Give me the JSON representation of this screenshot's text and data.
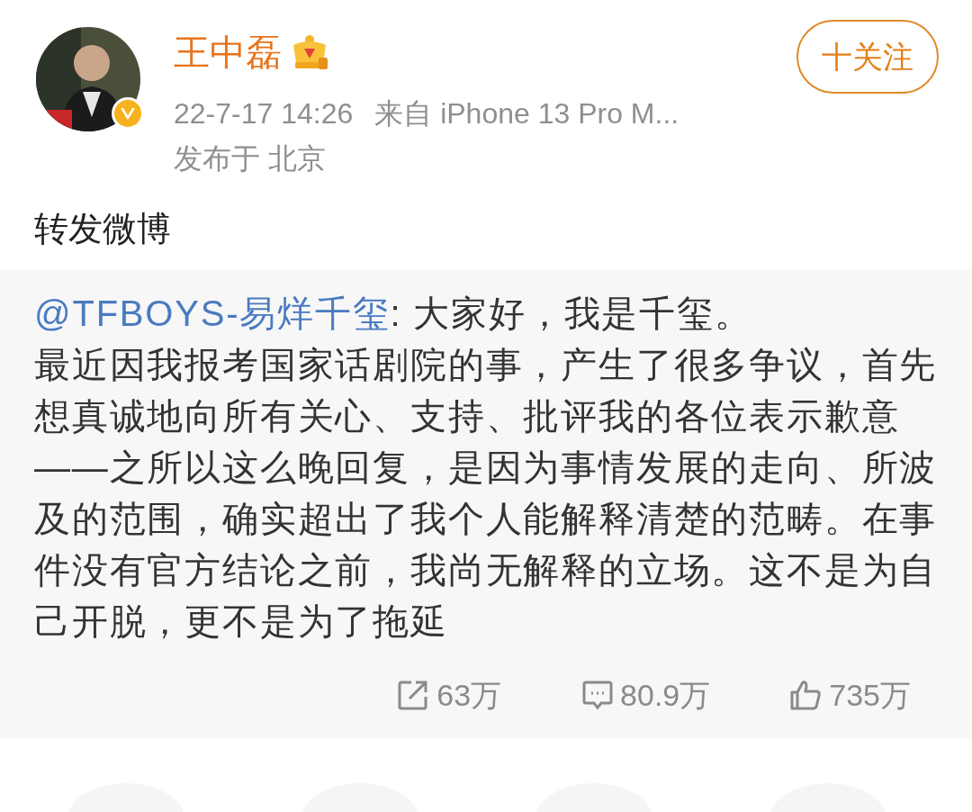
{
  "author": {
    "name": "王中磊",
    "verified": true,
    "follow_button": "十关注"
  },
  "meta": {
    "time": "22-7-17 14:26",
    "source": "来自 iPhone 13 Pro M...",
    "location": "发布于 北京"
  },
  "post_text": "转发微博",
  "repost": {
    "mention": "@TFBOYS-易烊千玺",
    "greeting": ": 大家好，我是千玺。",
    "text": "最近因我报考国家话剧院的事，产生了很多争议，首先想真诚地向所有关心、支持、批评我的各位表示歉意——之所以这么晚回复，是因为事情发展的走向、所波及的范围，确实超出了我个人能解释清楚的范畴。在事件没有官方结论之前，我尚无解释的立场。这不是为自己开脱，更不是为了拖延",
    "stats": [
      {
        "kind": "repost",
        "count": "63万"
      },
      {
        "kind": "comment",
        "count": "80.9万"
      },
      {
        "kind": "like",
        "count": "735万"
      }
    ]
  }
}
